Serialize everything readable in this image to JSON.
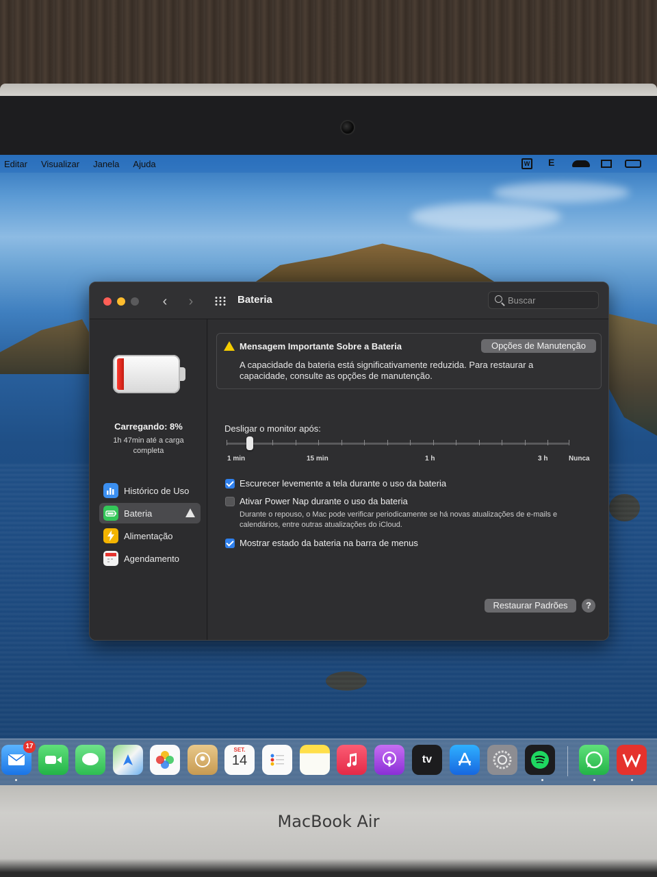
{
  "menubar": {
    "items": [
      "Editar",
      "Visualizar",
      "Janela",
      "Ajuda"
    ]
  },
  "window": {
    "title": "Bateria",
    "search_placeholder": "Buscar",
    "battery_status": {
      "title": "Carregando: 8%",
      "subtitle": "1h 47min até a carga completa",
      "level_percent": 8
    },
    "sidebar": [
      {
        "label": "Histórico de Uso",
        "icon": "bar-chart-icon",
        "color": "#3b8ff0"
      },
      {
        "label": "Bateria",
        "icon": "battery-icon",
        "color": "#34c759",
        "active": true
      },
      {
        "label": "Alimentação",
        "icon": "lightning-icon",
        "color": "#f4b400"
      },
      {
        "label": "Agendamento",
        "icon": "calendar-icon",
        "color": "#f2f2f2"
      }
    ],
    "alert": {
      "title": "Mensagem Importante Sobre a Bateria",
      "button": "Opções de Manutenção",
      "text": "A capacidade da bateria está significativamente reduzida. Para restaurar a capacidade, consulte as opções de manutenção."
    },
    "slider": {
      "label": "Desligar o monitor após:",
      "ticks": [
        "1 min",
        "15 min",
        "1 h",
        "3 h",
        "Nunca"
      ],
      "value": "2 min"
    },
    "options": [
      {
        "label": "Escurecer levemente a tela durante o uso da bateria",
        "checked": true
      },
      {
        "label": "Ativar Power Nap durante o uso da bateria",
        "checked": false,
        "description": "Durante o repouso, o Mac pode verificar periodicamente se há novas atualizações de e-mails e calendários, entre outras atualizações do iCloud."
      },
      {
        "label": "Mostrar estado da bateria na barra de menus",
        "checked": true
      }
    ],
    "restore_button": "Restaurar Padrões",
    "help_label": "?"
  },
  "dock": {
    "mail_badge": "17",
    "calendar_month": "SET.",
    "calendar_day": "14",
    "tv_label": "tv"
  },
  "brand": "MacBook Air",
  "colors": {
    "accent": "#2f80ed",
    "warning": "#f4cc00",
    "battery_low": "#ff3b30"
  }
}
